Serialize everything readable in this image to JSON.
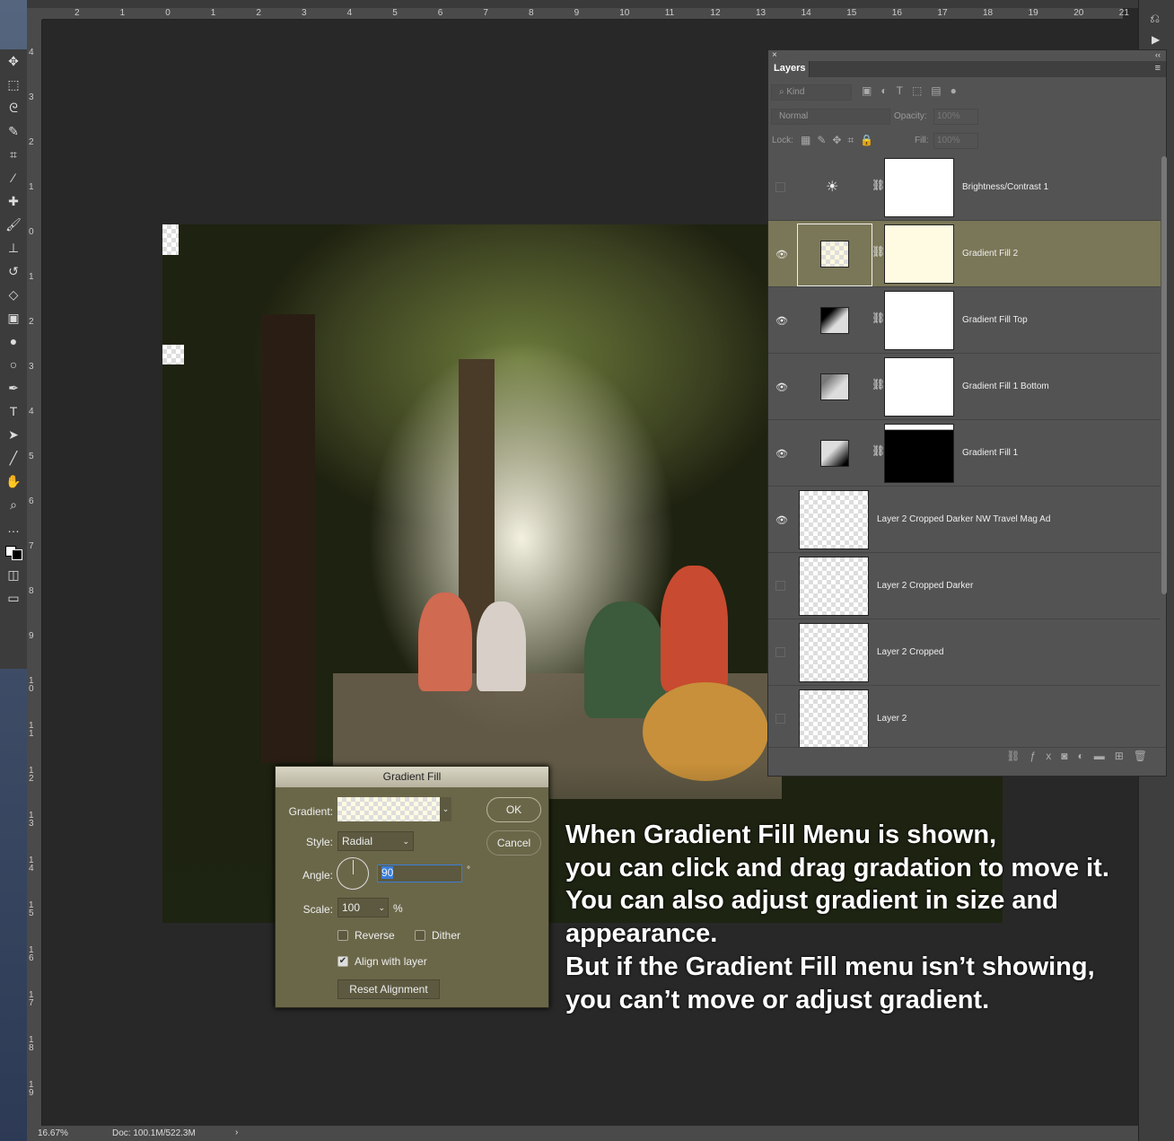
{
  "ruler": {
    "h_ticks": [
      "2",
      "1",
      "0",
      "1",
      "2",
      "3",
      "4",
      "5",
      "6",
      "7",
      "8",
      "9",
      "10",
      "11",
      "12",
      "13",
      "14",
      "15",
      "16",
      "17",
      "18",
      "19",
      "20",
      "21"
    ],
    "v_ticks": [
      "4",
      "3",
      "2",
      "1",
      "0",
      "1",
      "2",
      "3",
      "4",
      "5",
      "6",
      "7",
      "8",
      "9",
      "1 0",
      "1 1",
      "1 2",
      "1 3",
      "1 4",
      "1 5",
      "1 6",
      "1 7",
      "1 8",
      "1 9"
    ]
  },
  "status": {
    "zoom": "16.67%",
    "doc": "Doc: 100.1M/522.3M",
    "arrow": "›"
  },
  "layers_panel": {
    "tab": "Layers",
    "filter_kind": "Kind",
    "blend_mode": "Normal",
    "opacity_label": "Opacity:",
    "opacity_value": "100%",
    "lock_label": "Lock:",
    "fill_label": "Fill:",
    "fill_value": "100%",
    "layers": [
      {
        "name": "Brightness/Contrast 1",
        "visible": false,
        "selected": false
      },
      {
        "name": "Gradient Fill 2",
        "visible": true,
        "selected": true
      },
      {
        "name": "Gradient Fill Top",
        "visible": true,
        "selected": false
      },
      {
        "name": "Gradient Fill 1 Bottom",
        "visible": true,
        "selected": false
      },
      {
        "name": "Gradient Fill 1",
        "visible": true,
        "selected": false
      },
      {
        "name": "Layer 2 Cropped Darker NW Travel Mag Ad",
        "visible": true,
        "selected": false
      },
      {
        "name": "Layer 2 Cropped Darker",
        "visible": false,
        "selected": false
      },
      {
        "name": "Layer 2 Cropped",
        "visible": false,
        "selected": false
      },
      {
        "name": "Layer 2",
        "visible": false,
        "selected": false
      }
    ],
    "selected_color": "#7a7758"
  },
  "dialog": {
    "title": "Gradient Fill",
    "gradient_label": "Gradient:",
    "style_label": "Style:",
    "style_value": "Radial",
    "angle_label": "Angle:",
    "angle_value": "90",
    "degree": "°",
    "scale_label": "Scale:",
    "scale_value": "100",
    "percent": "%",
    "reverse": "Reverse",
    "reverse_checked": false,
    "dither": "Dither",
    "dither_checked": false,
    "align": "Align with layer",
    "align_checked": true,
    "reset": "Reset Alignment",
    "ok": "OK",
    "cancel": "Cancel"
  },
  "annotation": [
    "When Gradient Fill Menu is shown,",
    "you can click and drag gradation to move it.",
    "You can also adjust gradient in size and",
    "appearance.",
    "But if the Gradient Fill menu isn’t showing,",
    "you can’t move or adjust gradient."
  ]
}
